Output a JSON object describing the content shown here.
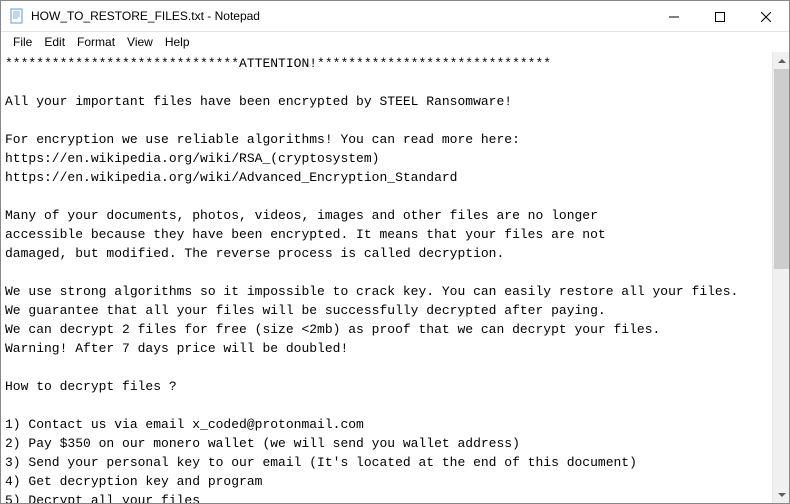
{
  "window": {
    "title": "HOW_TO_RESTORE_FILES.txt - Notepad"
  },
  "menu": {
    "file": "File",
    "edit": "Edit",
    "format": "Format",
    "view": "View",
    "help": "Help"
  },
  "document": {
    "text": "******************************ATTENTION!******************************\n\nAll your important files have been encrypted by STEEL Ransomware!\n\nFor encryption we use reliable algorithms! You can read more here:\nhttps://en.wikipedia.org/wiki/RSA_(cryptosystem)\nhttps://en.wikipedia.org/wiki/Advanced_Encryption_Standard\n\nMany of your documents, photos, videos, images and other files are no longer\naccessible because they have been encrypted. It means that your files are not\ndamaged, but modified. The reverse process is called decryption.\n\nWe use strong algorithms so it impossible to crack key. You can easily restore all your files.\nWe guarantee that all your files will be successfully decrypted after paying.\nWe can decrypt 2 files for free (size <2mb) as proof that we can decrypt your files.\nWarning! After 7 days price will be doubled!\n\nHow to decrypt files ?\n\n1) Contact us via email x_coded@protonmail.com\n2) Pay $350 on our monero wallet (we will send you wallet address)\n3) Send your personal key to our email (It's located at the end of this document)\n4) Get decryption key and program\n5) Decrypt all your files"
  }
}
